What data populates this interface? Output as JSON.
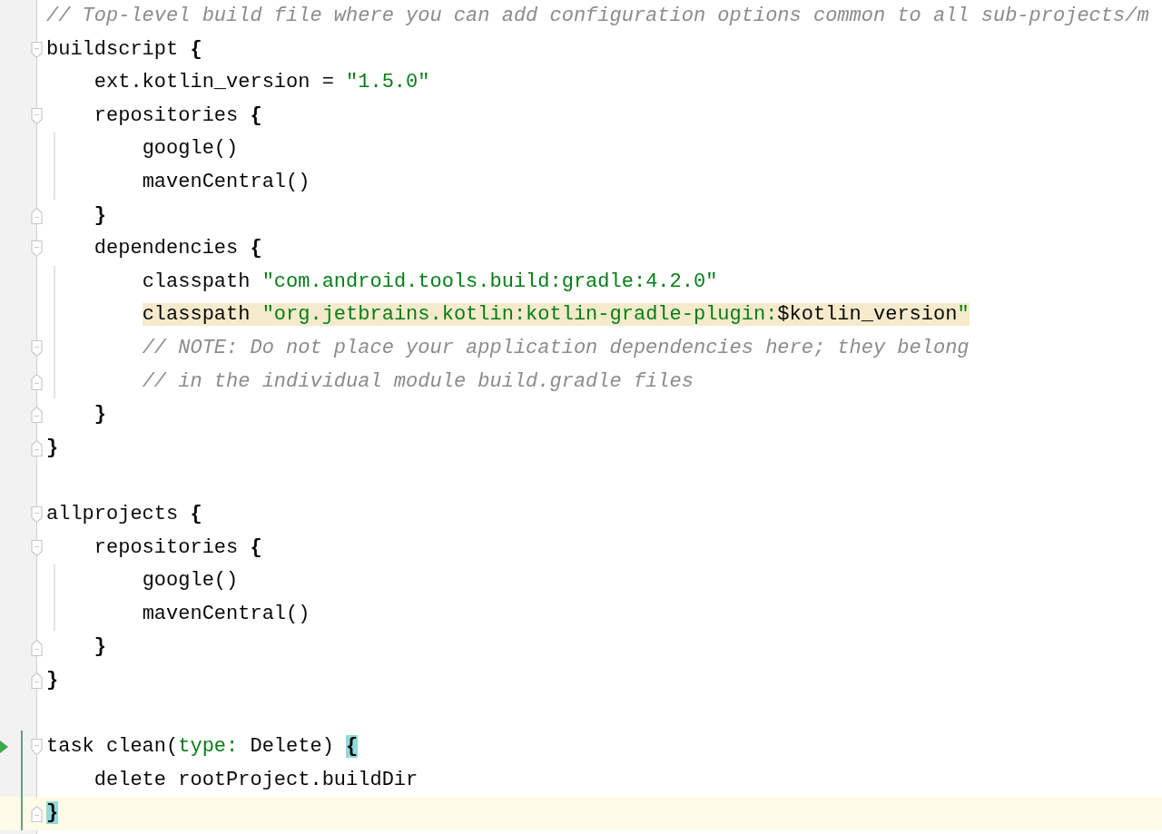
{
  "editor": {
    "lines": [
      {
        "kind": "line",
        "tokens": [
          {
            "kind": "comment",
            "text": "// Top-level build file where you can add configuration options common to all sub-projects/m"
          }
        ]
      },
      {
        "kind": "block_start",
        "tokens": [
          {
            "kind": "plain",
            "text": "buildscript "
          },
          {
            "kind": "brace",
            "text": "{"
          }
        ]
      },
      {
        "kind": "line",
        "tokens": [
          {
            "kind": "plain",
            "text": "    ext.kotlin_version = "
          },
          {
            "kind": "string",
            "text": "\"1.5.0\""
          }
        ]
      },
      {
        "kind": "block_start",
        "tokens": [
          {
            "kind": "plain",
            "text": "    repositories "
          },
          {
            "kind": "brace",
            "text": "{"
          }
        ]
      },
      {
        "kind": "line",
        "tokens": [
          {
            "kind": "plain",
            "text": "        google()"
          }
        ]
      },
      {
        "kind": "line",
        "tokens": [
          {
            "kind": "plain",
            "text": "        mavenCentral()"
          }
        ]
      },
      {
        "kind": "block_end",
        "tokens": [
          {
            "kind": "brace",
            "text": "    }"
          }
        ]
      },
      {
        "kind": "block_start",
        "tokens": [
          {
            "kind": "plain",
            "text": "    dependencies "
          },
          {
            "kind": "brace",
            "text": "{"
          }
        ]
      },
      {
        "kind": "line",
        "tokens": [
          {
            "kind": "plain",
            "text": "        classpath "
          },
          {
            "kind": "string",
            "text": "\"com.android.tools.build:gradle:4.2.0\""
          }
        ]
      },
      {
        "kind": "line",
        "usage": true,
        "tokens": [
          {
            "kind": "plain",
            "text": "        classpath "
          },
          {
            "kind": "string",
            "text": "\"org.jetbrains.kotlin:kotlin-gradle-plugin:"
          },
          {
            "kind": "plain",
            "text": "$kotlin_version"
          },
          {
            "kind": "string",
            "text": "\""
          }
        ]
      },
      {
        "kind": "block_start",
        "tokens": [
          {
            "kind": "comment",
            "text": "        // NOTE: Do not place your application dependencies here; they belong"
          }
        ]
      },
      {
        "kind": "block_end",
        "tokens": [
          {
            "kind": "comment",
            "text": "        // in the individual module build.gradle files"
          }
        ]
      },
      {
        "kind": "block_end",
        "tokens": [
          {
            "kind": "brace",
            "text": "    }"
          }
        ]
      },
      {
        "kind": "block_end",
        "tokens": [
          {
            "kind": "brace",
            "text": "}"
          }
        ]
      },
      {
        "kind": "blank"
      },
      {
        "kind": "block_start",
        "tokens": [
          {
            "kind": "plain",
            "text": "allprojects "
          },
          {
            "kind": "brace",
            "text": "{"
          }
        ]
      },
      {
        "kind": "block_start",
        "tokens": [
          {
            "kind": "plain",
            "text": "    repositories "
          },
          {
            "kind": "brace",
            "text": "{"
          }
        ]
      },
      {
        "kind": "line",
        "tokens": [
          {
            "kind": "plain",
            "text": "        google()"
          }
        ]
      },
      {
        "kind": "line",
        "tokens": [
          {
            "kind": "plain",
            "text": "        mavenCentral()"
          }
        ]
      },
      {
        "kind": "block_end",
        "tokens": [
          {
            "kind": "brace",
            "text": "    }"
          }
        ]
      },
      {
        "kind": "block_end",
        "tokens": [
          {
            "kind": "brace",
            "text": "}"
          }
        ]
      },
      {
        "kind": "blank"
      },
      {
        "kind": "block_start",
        "run": true,
        "changed": true,
        "tokens": [
          {
            "kind": "plain",
            "text": "task clean("
          },
          {
            "kind": "param",
            "text": "type:"
          },
          {
            "kind": "plain",
            "text": " Delete) "
          },
          {
            "kind": "brace",
            "text": "{",
            "match": true
          }
        ]
      },
      {
        "kind": "line",
        "changed": true,
        "tokens": [
          {
            "kind": "plain",
            "text": "    delete rootProject.buildDir"
          }
        ]
      },
      {
        "kind": "block_end",
        "changed": true,
        "current": true,
        "tokens": [
          {
            "kind": "brace",
            "text": "}",
            "match": true
          }
        ]
      }
    ]
  }
}
